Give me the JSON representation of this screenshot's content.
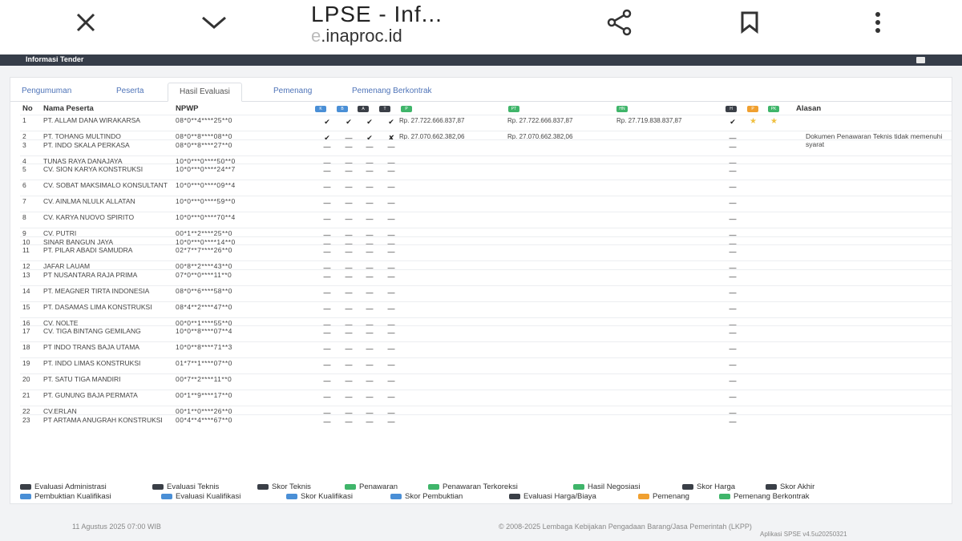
{
  "browser": {
    "title": "LPSE - Inf...",
    "url_prefix": "",
    "url_faded": "e",
    "url": ".inaproc.id",
    "icons": [
      "close-icon",
      "chevron-down-icon",
      "share-icon",
      "bookmark-icon",
      "kebab-menu-icon"
    ]
  },
  "topbar": {
    "title": "Informasi Tender"
  },
  "tabs": [
    {
      "label": "Pengumuman"
    },
    {
      "label": "Peserta"
    },
    {
      "label": "Hasil Evaluasi"
    },
    {
      "label": "Pemenang"
    },
    {
      "label": "Pemenang Berkontrak"
    }
  ],
  "table": {
    "headers": {
      "no": "No",
      "name": "Nama Peserta",
      "npwp": "NPWP",
      "reason": "Alasan"
    },
    "badges": [
      {
        "label": "K",
        "color": "#4a8fd6"
      },
      {
        "label": "B",
        "color": "#4a8fd6"
      },
      {
        "label": "A",
        "color": "#3a3f47"
      },
      {
        "label": "T",
        "color": "#3a3f47"
      },
      {
        "label": "P",
        "color": "#3fb56a"
      },
      {
        "label": "PT",
        "color": "#3fb56a"
      },
      {
        "label": "HN",
        "color": "#3fb56a"
      },
      {
        "label": "H",
        "color": "#3a3f47"
      },
      {
        "label": "P",
        "color": "#f0a030"
      },
      {
        "label": "PK",
        "color": "#3fb56a"
      }
    ],
    "rows": [
      {
        "no": "1",
        "name": "PT. Allam Dana Wirakarsa",
        "npwp": "08*0**4****25**0",
        "s": [
          "✔",
          "✔",
          "✔",
          "✔"
        ],
        "p": "Rp. 27.722.666.837,87",
        "pt": "Rp. 27.722.666.837,87",
        "hn": "Rp. 27.719.838.837,87",
        "h": "✔",
        "stars": "2",
        "reason": ""
      },
      {
        "no": "2",
        "name": "PT. TOHANG MULTINDO",
        "npwp": "08*0**8****08**0",
        "s": [
          "✔",
          "—",
          "✔",
          "✘"
        ],
        "p": "Rp. 27.070.662.382,06",
        "pt": "Rp. 27.070.662.382,06",
        "hn": "",
        "h": "—",
        "stars": "0",
        "reason": "Dokumen Penawaran Teknis tidak memenuhi syarat"
      },
      {
        "no": "3",
        "name": "PT. INDO SKALA PERKASA",
        "npwp": "08*0**8****27**0",
        "s": [
          "—",
          "—",
          "—",
          "—"
        ],
        "p": "",
        "pt": "",
        "hn": "",
        "h": "—",
        "stars": "0",
        "reason": ""
      },
      {
        "no": "4",
        "name": "TUNAS RAYA DANAJAYA",
        "npwp": "10*0***0****50**0",
        "s": [
          "—",
          "—",
          "—",
          "—"
        ],
        "p": "",
        "pt": "",
        "hn": "",
        "h": "—",
        "stars": "0",
        "reason": ""
      },
      {
        "no": "5",
        "name": "CV. SION KARYA KONSTRUKSI",
        "npwp": "10*0***0****24**7",
        "s": [
          "—",
          "—",
          "—",
          "—"
        ],
        "p": "",
        "pt": "",
        "hn": "",
        "h": "—",
        "stars": "0",
        "reason": ""
      },
      {
        "no": "6",
        "name": "CV. SOBAT MAKSIMALO KONSULTANT",
        "npwp": "10*0***0****09**4",
        "s": [
          "—",
          "—",
          "—",
          "—"
        ],
        "p": "",
        "pt": "",
        "hn": "",
        "h": "—",
        "stars": "0",
        "reason": ""
      },
      {
        "no": "7",
        "name": "CV. AINLMA NLULK ALLATAN",
        "npwp": "10*0***0****59**0",
        "s": [
          "—",
          "—",
          "—",
          "—"
        ],
        "p": "",
        "pt": "",
        "hn": "",
        "h": "—",
        "stars": "0",
        "reason": ""
      },
      {
        "no": "8",
        "name": "CV. KARYA NUOVO SPIRITO",
        "npwp": "10*0***0****70**4",
        "s": [
          "—",
          "—",
          "—",
          "—"
        ],
        "p": "",
        "pt": "",
        "hn": "",
        "h": "—",
        "stars": "0",
        "reason": ""
      },
      {
        "no": "9",
        "name": "CV. PUTRI",
        "npwp": "00*1**2****25**0",
        "s": [
          "—",
          "—",
          "—",
          "—"
        ],
        "p": "",
        "pt": "",
        "hn": "",
        "h": "—",
        "stars": "0",
        "reason": ""
      },
      {
        "no": "10",
        "name": "Sinar bangun jaya",
        "npwp": "10*0***0****14**0",
        "s": [
          "—",
          "—",
          "—",
          "—"
        ],
        "p": "",
        "pt": "",
        "hn": "",
        "h": "—",
        "stars": "0",
        "reason": ""
      },
      {
        "no": "11",
        "name": "PT. PILAR ABADI SAMUDRA",
        "npwp": "02*7**7****26**0",
        "s": [
          "—",
          "—",
          "—",
          "—"
        ],
        "p": "",
        "pt": "",
        "hn": "",
        "h": "—",
        "stars": "0",
        "reason": ""
      },
      {
        "no": "12",
        "name": "Jafar Lauam",
        "npwp": "00*8**2****43**0",
        "s": [
          "—",
          "—",
          "—",
          "—"
        ],
        "p": "",
        "pt": "",
        "hn": "",
        "h": "—",
        "stars": "0",
        "reason": ""
      },
      {
        "no": "13",
        "name": "PT Nusantara Raja Prima",
        "npwp": "07*0**0****11**0",
        "s": [
          "—",
          "—",
          "—",
          "—"
        ],
        "p": "",
        "pt": "",
        "hn": "",
        "h": "—",
        "stars": "0",
        "reason": ""
      },
      {
        "no": "14",
        "name": "PT. Meagner Tirta Indonesia",
        "npwp": "08*0**6****58**0",
        "s": [
          "—",
          "—",
          "—",
          "—"
        ],
        "p": "",
        "pt": "",
        "hn": "",
        "h": "—",
        "stars": "0",
        "reason": ""
      },
      {
        "no": "15",
        "name": "PT. DASAMAS LIMA KONSTRUKSI",
        "npwp": "08*4**2****47**0",
        "s": [
          "—",
          "—",
          "—",
          "—"
        ],
        "p": "",
        "pt": "",
        "hn": "",
        "h": "—",
        "stars": "0",
        "reason": ""
      },
      {
        "no": "16",
        "name": "CV. NOLTE",
        "npwp": "00*0**1****55**0",
        "s": [
          "—",
          "—",
          "—",
          "—"
        ],
        "p": "",
        "pt": "",
        "hn": "",
        "h": "—",
        "stars": "0",
        "reason": ""
      },
      {
        "no": "17",
        "name": "CV. TIGA BINTANG GEMILANG",
        "npwp": "10*0**8****07**4",
        "s": [
          "—",
          "—",
          "—",
          "—"
        ],
        "p": "",
        "pt": "",
        "hn": "",
        "h": "—",
        "stars": "0",
        "reason": ""
      },
      {
        "no": "18",
        "name": "PT INDO TRANS BAJA UTAMA",
        "npwp": "10*0**8****71**3",
        "s": [
          "—",
          "—",
          "—",
          "—"
        ],
        "p": "",
        "pt": "",
        "hn": "",
        "h": "—",
        "stars": "0",
        "reason": ""
      },
      {
        "no": "19",
        "name": "PT. INDO LIMAS KONSTRUKSI",
        "npwp": "01*7**1****07**0",
        "s": [
          "—",
          "—",
          "—",
          "—"
        ],
        "p": "",
        "pt": "",
        "hn": "",
        "h": "—",
        "stars": "0",
        "reason": ""
      },
      {
        "no": "20",
        "name": "PT. SATU TIGA MANDIRI",
        "npwp": "00*7**2****11**0",
        "s": [
          "—",
          "—",
          "—",
          "—"
        ],
        "p": "",
        "pt": "",
        "hn": "",
        "h": "—",
        "stars": "0",
        "reason": ""
      },
      {
        "no": "21",
        "name": "PT. GUNUNG BAJA PERMATA",
        "npwp": "00*1**9****17**0",
        "s": [
          "—",
          "—",
          "—",
          "—"
        ],
        "p": "",
        "pt": "",
        "hn": "",
        "h": "—",
        "stars": "0",
        "reason": ""
      },
      {
        "no": "22",
        "name": "cv.erlan",
        "npwp": "00*1**0****26**0",
        "s": [
          "—",
          "—",
          "—",
          "—"
        ],
        "p": "",
        "pt": "",
        "hn": "",
        "h": "—",
        "stars": "0",
        "reason": ""
      },
      {
        "no": "23",
        "name": "PT Artama Anugrah Konstruksi",
        "npwp": "00*4**4****67**0",
        "s": [
          "—",
          "—",
          "—",
          "—"
        ],
        "p": "",
        "pt": "",
        "hn": "",
        "h": "—",
        "stars": "0",
        "reason": ""
      }
    ]
  },
  "legend": {
    "row1": [
      {
        "label": "Evaluasi Administrasi",
        "color": "#3a3f47"
      },
      {
        "label": "Evaluasi Teknis",
        "color": "#3a3f47"
      },
      {
        "label": "Skor Teknis",
        "color": "#3a3f47"
      },
      {
        "label": "Penawaran",
        "color": "#3fb56a"
      },
      {
        "label": "Penawaran Terkoreksi",
        "color": "#3fb56a"
      },
      {
        "label": "Hasil Negosiasi",
        "color": "#3fb56a"
      },
      {
        "label": "Skor Harga",
        "color": "#3a3f47"
      },
      {
        "label": "Skor Akhir",
        "color": "#3a3f47"
      }
    ],
    "row2": [
      {
        "label": "Pembuktian Kualifikasi",
        "color": "#4a8fd6"
      },
      {
        "label": "Evaluasi Kualifikasi",
        "color": "#4a8fd6"
      },
      {
        "label": "Skor Kualifikasi",
        "color": "#4a8fd6"
      },
      {
        "label": "Skor Pembuktian",
        "color": "#4a8fd6"
      },
      {
        "label": "Evaluasi Harga/Biaya",
        "color": "#3a3f47"
      },
      {
        "label": "Pemenang",
        "color": "#f0a030"
      },
      {
        "label": "Pemenang Berkontrak",
        "color": "#3fb56a"
      }
    ]
  },
  "footer": {
    "date": "11 Agustus 2025 07:00 WIB",
    "copyright": "© 2008-2025 Lembaga Kebijakan Pengadaan Barang/Jasa Pemerintah (LKPP)",
    "version": "Aplikasi SPSE v4.5u20250321"
  }
}
